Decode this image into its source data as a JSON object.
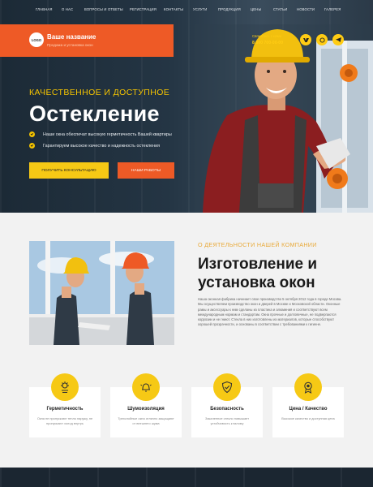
{
  "nav": [
    "ГЛАВНАЯ",
    "О НАС",
    "ВОПРОСЫ И ОТВЕТЫ",
    "РЕГИСТРАЦИЯ",
    "КОНТАКТЫ",
    "УСЛУГИ",
    "ПРОДУКЦИЯ",
    "ЦЕНЫ",
    "СТАТЬИ",
    "НОВОСТИ",
    "ГАЛЕРЕЯ"
  ],
  "brand": {
    "logo": "LOGO",
    "name": "Ваше название",
    "sub": "Продажа и установка окон"
  },
  "contact": {
    "label": "Свяжитесь с нами",
    "phone": "8 800 700-00-00"
  },
  "hero": {
    "kicker": "КАЧЕСТВЕННОЕ И ДОСТУПНОЕ",
    "title": "Остекление",
    "features": [
      "Наши окна обеспечат высокую герметичность Вашей квартиры",
      "Гарантируем высокое качество и надежность остекления"
    ],
    "btn_primary": "ПОЛУЧИТЬ КОНСУЛЬТАЦИЮ",
    "btn_secondary": "НАШИ РАБОТЫ"
  },
  "about": {
    "kicker": "О ДЕЯТЕЛЬНОСТИ НАШЕЙ КОМПАНИИ",
    "title": "Изготовление и установка окон",
    "text": "Наша оконная фабрика начинает свое производство 5 октября 2012 года в городе Москва. Мы осуществляем производство окон и дверей в Москве и Московской области. Оконные рамы и аксессуары к ним сделаны из пластика и алюминия и соответствуют всем международным нормам и стандартам. Окна прочные и долговечные, не подвергаются коррозии и не гниют. Стекла в них изготовлены из материалов, которые способствуют хорошей прозрачности, и основаны в соответствии с требованиями к гигиене."
  },
  "cards": [
    {
      "title": "Герметичность",
      "text": "Окна не пропускают тепло наружу, не пропускают холод внутрь"
    },
    {
      "title": "Шумоизоляция",
      "text": "Трехслойные окна отлично защищают от внешнего шума"
    },
    {
      "title": "Безопасность",
      "text": "Закаленное стекло повышает устойчивость к взлому"
    },
    {
      "title": "Цена / Качество",
      "text": "Высокое качество и доступная цена"
    }
  ]
}
